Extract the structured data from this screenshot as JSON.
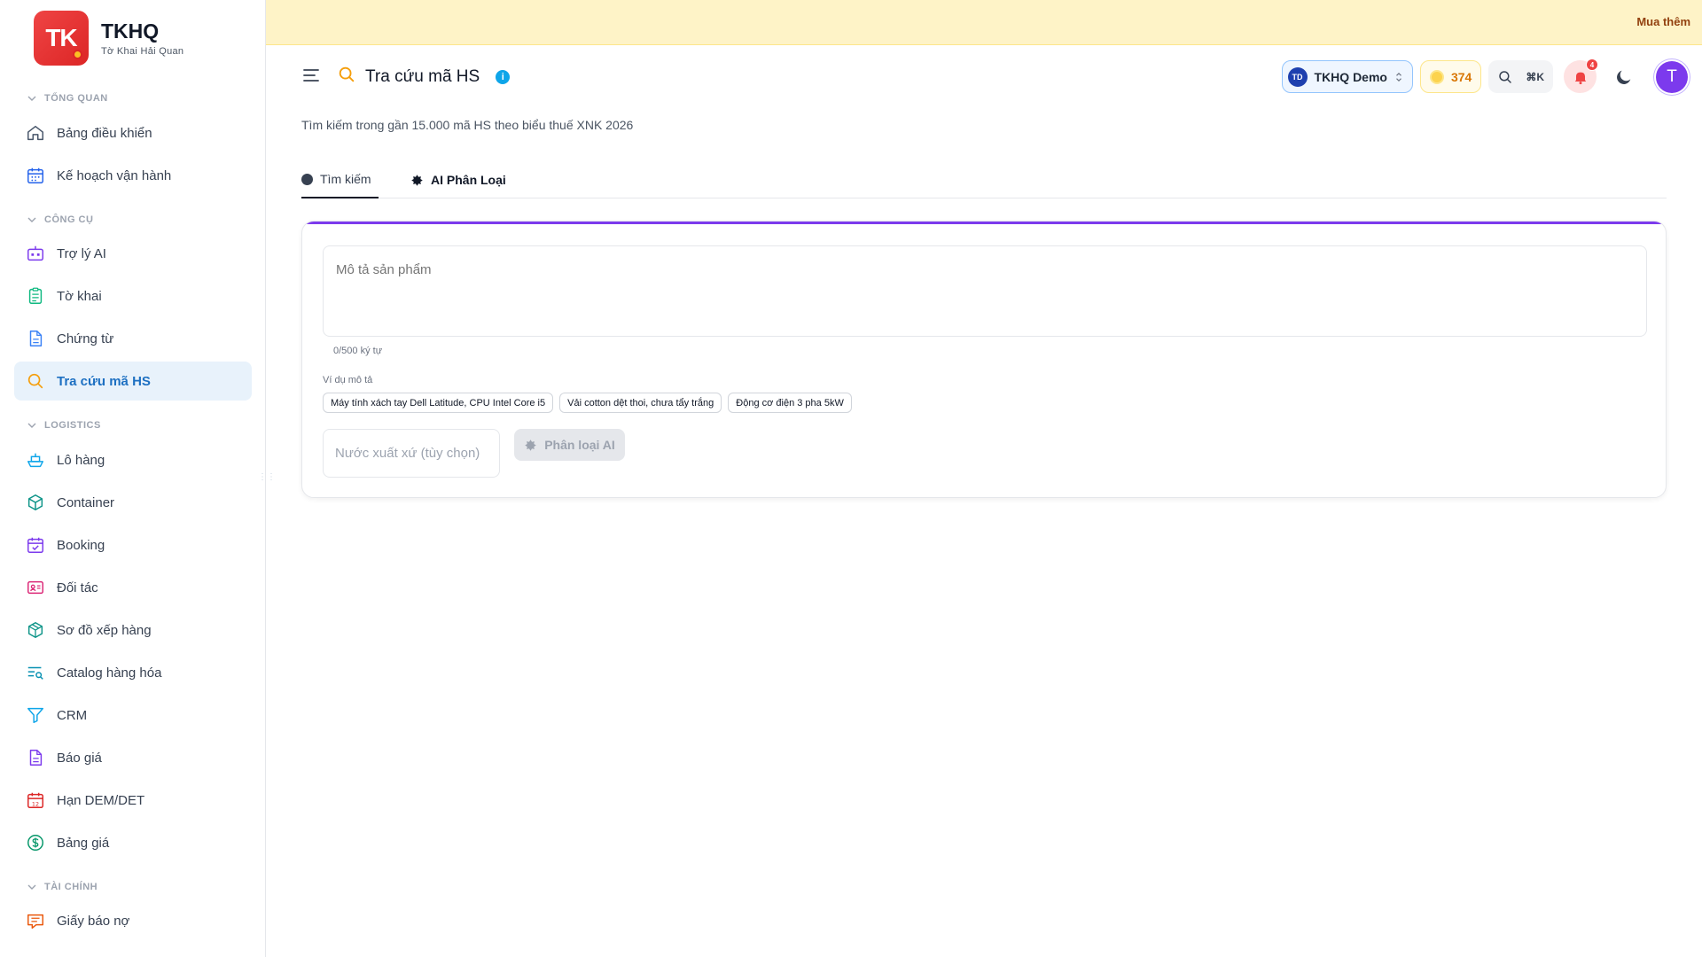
{
  "brand": {
    "logo_text": "TK",
    "name": "TKHQ",
    "subtitle": "Tờ Khai Hải Quan"
  },
  "sidebar": {
    "sections": [
      {
        "title": "TỔNG QUAN"
      },
      {
        "title": "CÔNG CỤ"
      },
      {
        "title": "LOGISTICS"
      },
      {
        "title": "TÀI CHÍNH"
      }
    ],
    "items": [
      {
        "label": "Bảng điều khiển",
        "icon": "home-icon"
      },
      {
        "label": "Kế hoạch vận hành",
        "icon": "calendar-grid-icon"
      },
      {
        "label": "Trợ lý AI",
        "icon": "bot-icon"
      },
      {
        "label": "Tờ khai",
        "icon": "clipboard-icon"
      },
      {
        "label": "Chứng từ",
        "icon": "document-icon"
      },
      {
        "label": "Tra cứu mã HS",
        "icon": "search-icon",
        "active": true
      },
      {
        "label": "Lô hàng",
        "icon": "ship-icon"
      },
      {
        "label": "Container",
        "icon": "box-icon"
      },
      {
        "label": "Booking",
        "icon": "calendar-check-icon"
      },
      {
        "label": "Đối tác",
        "icon": "contact-card-icon"
      },
      {
        "label": "Sơ đồ xếp hàng",
        "icon": "package-icon"
      },
      {
        "label": "Catalog hàng hóa",
        "icon": "list-search-icon"
      },
      {
        "label": "CRM",
        "icon": "funnel-icon"
      },
      {
        "label": "Báo giá",
        "icon": "file-text-icon"
      },
      {
        "label": "Hạn DEM/DET",
        "icon": "calendar-date-icon"
      },
      {
        "label": "Bảng giá",
        "icon": "dollar-circle-icon"
      },
      {
        "label": "Giấy báo nợ",
        "icon": "receipt-icon"
      }
    ]
  },
  "banner": {
    "link_label": "Mua thêm",
    "bg": "#fef3c7"
  },
  "header": {
    "title": "Tra cứu mã HS",
    "info_glyph": "i",
    "org_badge": "TD",
    "org_name": "TKHQ Demo",
    "credits": "374",
    "shortcut": "⌘K",
    "notification_count": "4",
    "avatar_initial": "T"
  },
  "main": {
    "subtitle": "Tìm kiếm trong gần 15.000 mã HS theo biểu thuế XNK 2026",
    "tabs": [
      {
        "label": "Tìm kiếm",
        "active": true
      },
      {
        "label": "AI Phân Loại"
      }
    ],
    "description_placeholder": "Mô tả sản phẩm",
    "char_count": "0/500 ký tự",
    "examples_label": "Ví dụ mô tả",
    "examples": [
      "Máy tính xách tay Dell Latitude, CPU Intel Core i5",
      "Vải cotton dệt thoi, chưa tẩy trắng",
      "Động cơ điện 3 pha 5kW"
    ],
    "origin_placeholder": "Nước xuất xứ (tùy chọn)",
    "classify_button": "Phân loại AI"
  },
  "colors": {
    "accent": "#7c3aed",
    "active_nav": "#1d70c2",
    "brand_red": "#ef4444"
  }
}
